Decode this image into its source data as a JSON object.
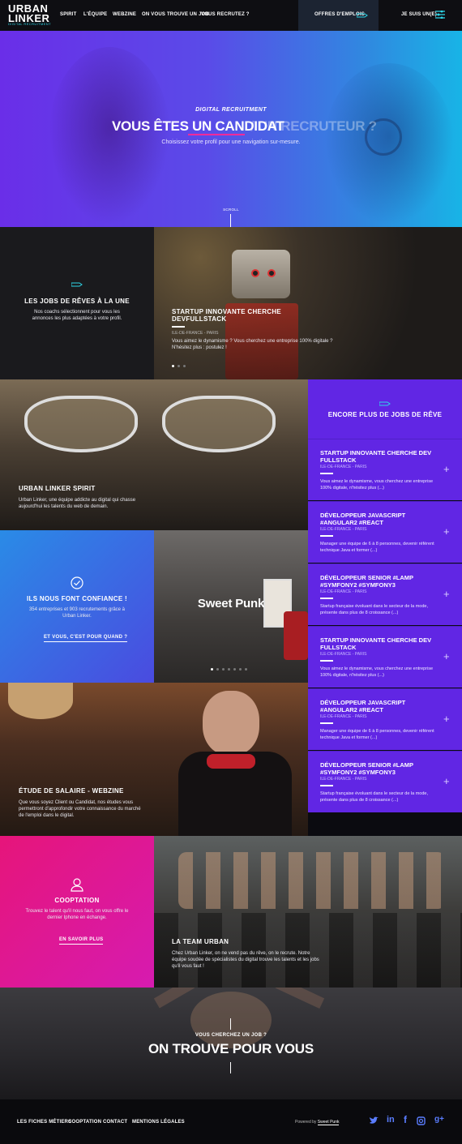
{
  "header": {
    "logo_line1": "URBAN",
    "logo_line2": "LINKER",
    "logo_tagline": "DIGITAL RECRUITMENT",
    "nav": [
      "SPIRIT",
      "L'ÉQUIPE",
      "WEBZINE",
      "ON VOUS TROUVE UN JOB",
      "VOUS RECRUTEZ ?"
    ],
    "jobs_button": "OFFRES D'EMPLOIS",
    "profile_label": "JE SUIS UN(E)"
  },
  "hero": {
    "kicker": "DIGITAL RECRUITMENT",
    "title_active": "VOUS ÊTES UN CANDIDAT",
    "title_inactive": "/ UN RECRUTEUR ?",
    "subtitle": "Choisissez votre profil pour une navigation sur-mesure.",
    "scroll": "SCROLL"
  },
  "dream_jobs": {
    "title": "LES JOBS DE RÊVES À LA UNE",
    "text": "Nos coachs sélectionnent pour vous les annonces les plus adaptées à votre profil.",
    "slide_title": "STARTUP INNOVANTE CHERCHE DEVFULLSTACK",
    "slide_location": "ILE-DE-FRANCE - PARIS",
    "slide_text": "Vous aimez le dynamisme ? Vous cherchez une entreprise 100% digitale ? N'hésitez plus : postulez !"
  },
  "spirit": {
    "title": "URBAN LINKER SPIRIT",
    "text": "Urban Linker, une équipe addicte au digital qui chasse aujourd'hui les talents du web de demain."
  },
  "more_jobs": {
    "title": "ENCORE PLUS DE JOBS DE RÊVE",
    "jobs": [
      {
        "title": "STARTUP INNOVANTE CHERCHE DEV FULLSTACK",
        "location": "ILE-DE-FRANCE - PARIS",
        "desc": "Vous aimez le dynamisme, vous cherchez une entreprise 100% digitale, n'hésitez plus (...)"
      },
      {
        "title": "DÉVELOPPEUR JAVASCRIPT #ANGULAR2 #REACT",
        "location": "ILE-DE-FRANCE - PARIS",
        "desc": "Manager une équipe de 6 à 8 personnes, devenir référent technique Java et former (...)"
      },
      {
        "title": "DÉVELOPPEUR SENIOR #LAMP #SYMFONY2 #SYMFONY3",
        "location": "ILE-DE-FRANCE - PARIS",
        "desc": "Startup française évoluant dans le secteur de la mode, présente dans plus de 8 croissance (...)"
      },
      {
        "title": "STARTUP INNOVANTE CHERCHE DEV FULLSTACK",
        "location": "ILE-DE-FRANCE - PARIS",
        "desc": "Vous aimez le dynamisme, vous cherchez une entreprise 100% digitale, n'hésitez plus (...)"
      },
      {
        "title": "DÉVELOPPEUR JAVASCRIPT #ANGULAR2 #REACT",
        "location": "ILE-DE-FRANCE - PARIS",
        "desc": "Manager une équipe de 6 à 8 personnes, devenir référent technique Java et former (...)"
      },
      {
        "title": "DÉVELOPPEUR SENIOR #LAMP #SYMFONY2 #SYMFONY3",
        "location": "ILE-DE-FRANCE - PARIS",
        "desc": "Startup française évoluant dans le secteur de la mode, présente dans plus de 8 croissance (...)"
      }
    ]
  },
  "trust": {
    "title": "ILS NOUS FONT CONFIANCE !",
    "text": "354 entreprises et 903 recrutements grâce à Urban Linker.",
    "link": "ET VOUS, C'EST POUR QUAND ?",
    "client_logo": "Sweet Punk"
  },
  "salary": {
    "title": "ÉTUDE DE SALAIRE - WEBZINE",
    "text": "Que vous soyez Client ou Candidat, nos études vous permettront d'approfondir votre connaissance du marché de l'emploi dans le digital."
  },
  "cooptation": {
    "title": "COOPTATION",
    "text": "Trouvez le talent qu'il nous faut, on vous offre le dernier Iphone en échange.",
    "link": "EN SAVOIR PLUS"
  },
  "team": {
    "title": "LA TEAM URBAN",
    "text": "Chez Urban Linker, on ne vend pas du rêve, on le recrute. Notre équipe soudée de spécialistes du digital trouve les talents et les jobs qu'il vous faut !"
  },
  "cta": {
    "kicker": "VOUS CHERCHEZ UN JOB ?",
    "title": "ON TROUVE POUR VOUS"
  },
  "footer": {
    "links": [
      "LES FICHES MÉTIERS",
      "COOPTATION",
      "CONTACT",
      "MENTIONS LÉGALES"
    ],
    "powered_prefix": "Powered by",
    "powered_by": "Sweet Punk",
    "social": [
      "twitter-icon",
      "linkedin-icon",
      "facebook-icon",
      "instagram-icon",
      "google-plus-icon"
    ]
  },
  "colors": {
    "accent_cyan": "#2ed6e8",
    "purple": "#6126e4",
    "pink": "#e6157a",
    "blue_cell": "#2f7fe0"
  }
}
